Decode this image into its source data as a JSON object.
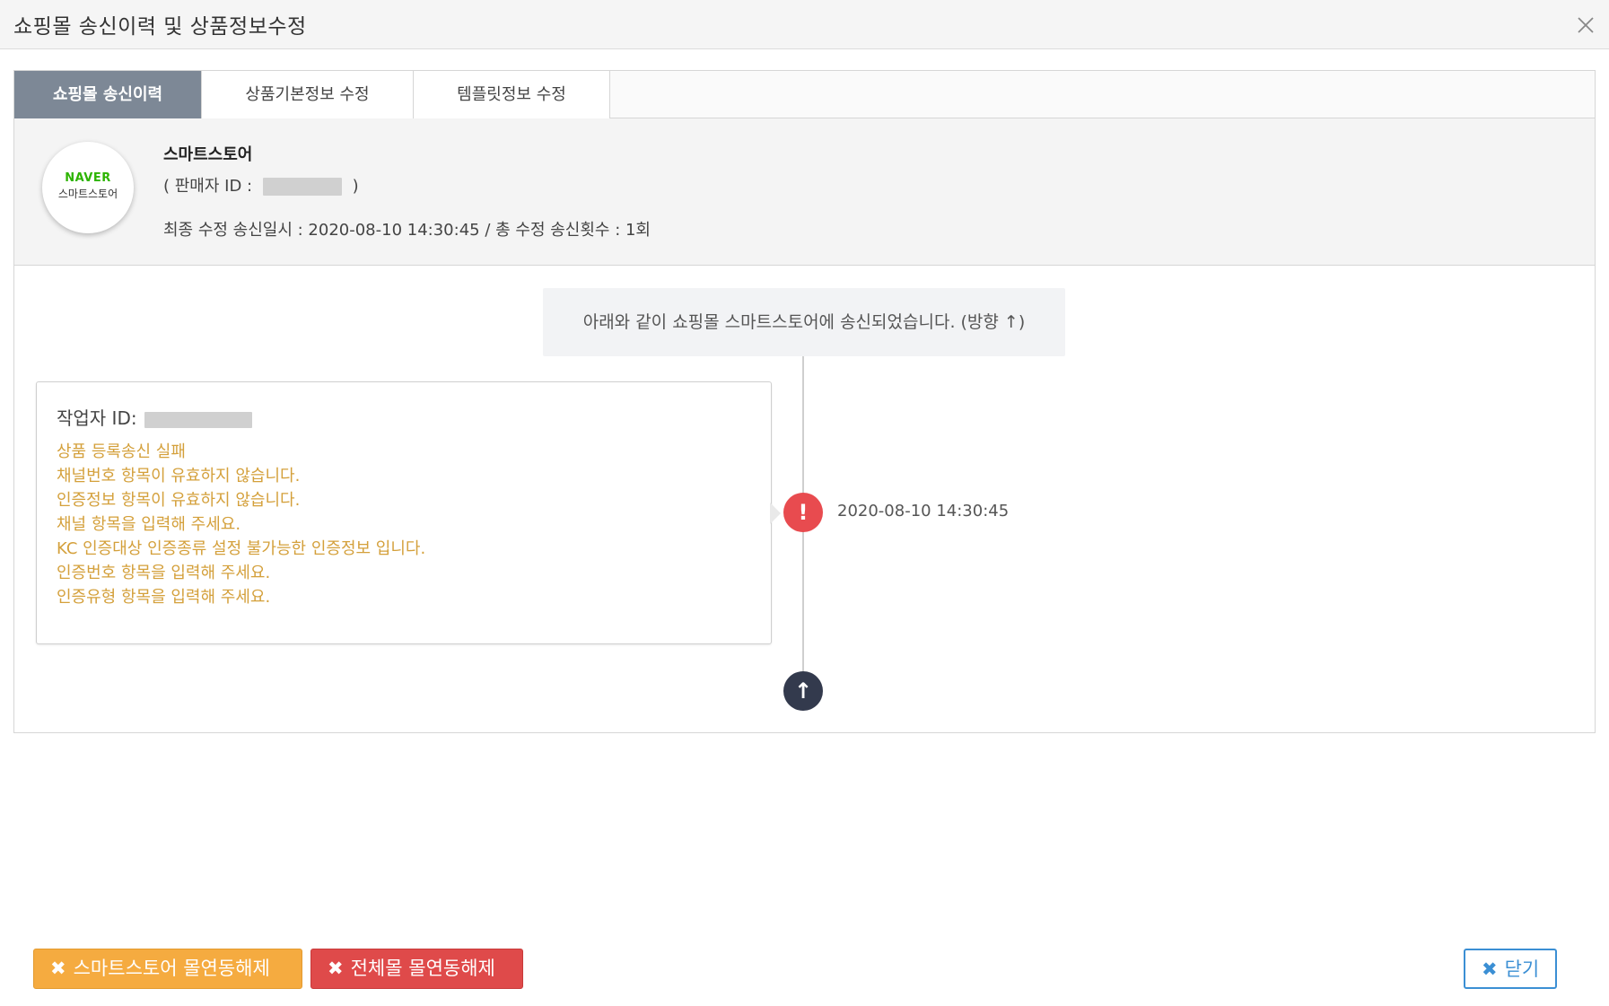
{
  "modal": {
    "title": "쇼핑몰 송신이력 및 상품정보수정"
  },
  "tabs": [
    {
      "label": "쇼핑몰 송신이력"
    },
    {
      "label": "상품기본정보 수정"
    },
    {
      "label": "템플릿정보 수정"
    }
  ],
  "store": {
    "logo_brand": "NAVER",
    "logo_sub": "스마트스토어",
    "name": "스마트스토어",
    "seller_prefix": "( 판매자 ID :",
    "seller_suffix": ")",
    "last_info": "최종 수정 송신일시 : 2020-08-10 14:30:45 / 총 수정 송신횟수 : 1회"
  },
  "timeline": {
    "header": "아래와 같이 쇼핑몰 스마트스토어에 송신되었습니다. (방향 ↑)",
    "entry": {
      "worker_label": "작업자 ID:",
      "messages": [
        "상품 등록송신 실패",
        "채널번호 항목이 유효하지 않습니다.",
        "인증정보 항목이 유효하지 않습니다.",
        "채널 항목을 입력해 주세요.",
        "KC 인증대상 인증종류 설정 불가능한 인증정보 입니다.",
        "인증번호 항목을 입력해 주세요.",
        "인증유형 항목을 입력해 주세요."
      ],
      "status_glyph": "!",
      "time": "2020-08-10 14:30:45"
    },
    "end_glyph": "↑"
  },
  "buttons": {
    "unlink_store": "스마트스토어 몰연동해제",
    "unlink_all": "전체몰 몰연동해제",
    "close": "닫기",
    "x_glyph": "✖"
  },
  "colors": {
    "tab_active": "#7d8896",
    "message_text": "#d4a03b",
    "error": "#e84b4f",
    "end_marker": "#333a4d",
    "btn_yellow": "#f5ab40",
    "btn_red": "#df4a4a",
    "btn_close": "#3b8fd4",
    "naver_green": "#2db400"
  }
}
